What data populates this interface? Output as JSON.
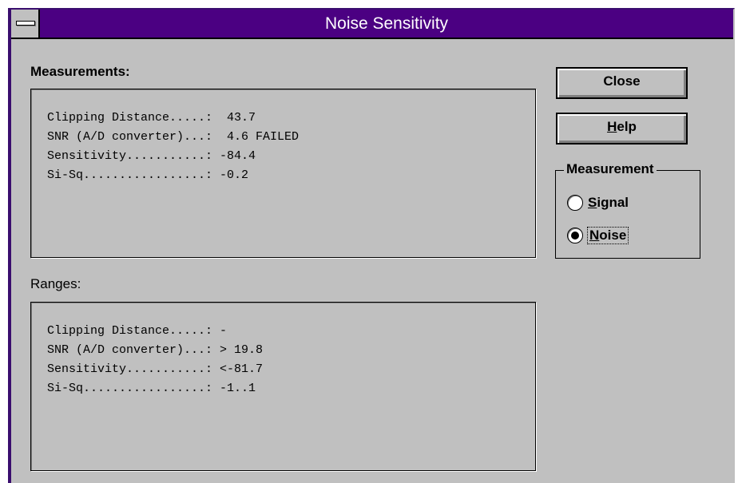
{
  "window": {
    "title": "Noise Sensitivity"
  },
  "measurements": {
    "heading": "Measurements:",
    "lines": [
      "Clipping Distance.....:  43.7",
      "SNR (A/D converter)...:  4.6 FAILED",
      "Sensitivity...........: -84.4",
      "Si-Sq.................: -0.2"
    ]
  },
  "ranges": {
    "heading": "Ranges:",
    "lines": [
      "Clipping Distance.....: -",
      "SNR (A/D converter)...: > 19.8",
      "Sensitivity...........: <-81.7",
      "Si-Sq.................: -1..1"
    ]
  },
  "buttons": {
    "close": "Close",
    "help_mnemonic": "H",
    "help_rest": "elp"
  },
  "measurement_group": {
    "title": "Measurement",
    "signal_mnemonic": "S",
    "signal_rest": "ignal",
    "noise_mnemonic": "N",
    "noise_rest": "oise",
    "selected": "Noise"
  },
  "icons": {
    "system_menu": "system-menu-icon"
  }
}
